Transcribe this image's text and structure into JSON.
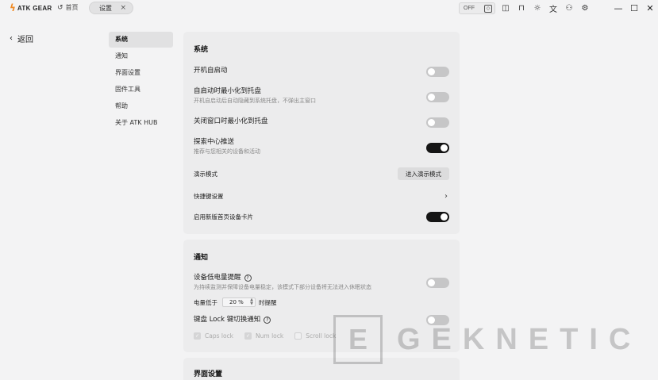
{
  "titlebar": {
    "logo_text": "ATK GEAR",
    "home_label": "首页",
    "active_tab": "设置",
    "off_label": "OFF",
    "icons": [
      "cube-icon",
      "chat-icon",
      "shirt-icon",
      "sun-icon",
      "translate-icon",
      "user-icon",
      "gear-icon"
    ],
    "window_controls": [
      "minimize-icon",
      "maximize-icon",
      "close-icon"
    ]
  },
  "back": {
    "label": "返回"
  },
  "nav": {
    "items": [
      {
        "label": "系统",
        "active": true
      },
      {
        "label": "通知",
        "active": false
      },
      {
        "label": "界面设置",
        "active": false
      },
      {
        "label": "固件工具",
        "active": false
      },
      {
        "label": "帮助",
        "active": false
      },
      {
        "label": "关于 ATK HUB",
        "active": false
      }
    ]
  },
  "system": {
    "title": "系统",
    "rows": [
      {
        "label": "开机自启动",
        "sub": "",
        "toggle": false
      },
      {
        "label": "自启动时最小化到托盘",
        "sub": "开机自启动后自动隐藏到系统托盘，不弹出主窗口",
        "toggle": false
      },
      {
        "label": "关闭窗口时最小化到托盘",
        "sub": "",
        "toggle": false
      },
      {
        "label": "探索中心推送",
        "sub": "推荐与您相关的设备和活动",
        "toggle": true
      }
    ],
    "demo_label": "演示模式",
    "demo_button": "进入演示模式",
    "shortcut_label": "快捷键设置",
    "new_card_label": "启用新版首页设备卡片",
    "new_card_toggle": true
  },
  "notify": {
    "title": "通知",
    "low_battery_label": "设备低电量提醒",
    "low_battery_sub": "为持续监测并保障设备电量稳定，该模式下部分设备将无法进入休眠状态",
    "low_battery_toggle": false,
    "battery_prefix": "电量低于",
    "battery_value": "20 %",
    "battery_suffix": "时提醒",
    "lock_label": "键盘 Lock 键切换通知",
    "lock_toggle": false,
    "checks": [
      {
        "label": "Caps lock",
        "checked": true
      },
      {
        "label": "Num lock",
        "checked": true
      },
      {
        "label": "Scroll lock",
        "checked": false
      }
    ]
  },
  "ui_settings": {
    "title": "界面设置"
  },
  "watermark": {
    "box": "E",
    "text": "GEKNETIC"
  },
  "colors": {
    "accent": "#f08a24",
    "toggle_on": "#151515",
    "toggle_off": "#c6c6c7"
  }
}
